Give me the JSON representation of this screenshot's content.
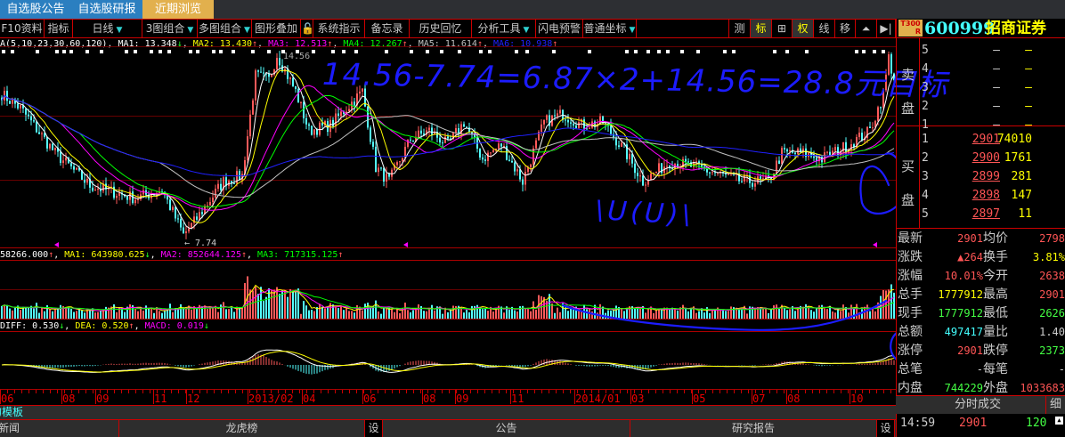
{
  "tabs": [
    {
      "label": "自选股公告"
    },
    {
      "label": "自选股研报"
    },
    {
      "label": "近期浏览",
      "active": true
    }
  ],
  "toolbar": {
    "left": [
      {
        "label": "F10资料"
      },
      {
        "label": "指标"
      },
      {
        "label": "日线",
        "dropdown": true
      },
      {
        "label": "3图组合",
        "dropdown": true
      },
      {
        "label": "多图组合",
        "dropdown": true
      },
      {
        "label": "图形叠加"
      },
      {
        "label": "🔓",
        "icon": "unlock-icon"
      },
      {
        "label": "系统指示"
      },
      {
        "label": "备忘录"
      },
      {
        "label": "历史回忆"
      },
      {
        "label": "分析工具",
        "dropdown": true
      },
      {
        "label": "闪电预警"
      },
      {
        "label": "普通坐标",
        "dropdown": true
      }
    ],
    "right": [
      {
        "label": "测"
      },
      {
        "label": "标",
        "active": true
      },
      {
        "label": "⊞"
      },
      {
        "label": "权",
        "active": true
      },
      {
        "label": "线"
      },
      {
        "label": "移"
      },
      {
        "label": "⏶"
      },
      {
        "label": "▶|"
      }
    ]
  },
  "stock": {
    "badge_top": "T300",
    "badge_bottom": "R",
    "code": "600999",
    "name": "招商证券"
  },
  "ma_legend": {
    "prefix": "A(5,10,23,30,60,120)",
    "items": [
      {
        "label": "MA1: 13.348",
        "arrow": "↓",
        "color": "#ffffff"
      },
      {
        "label": "MA2: 13.430",
        "arrow": "↑",
        "color": "#ffff00"
      },
      {
        "label": "MA3: 12.513",
        "arrow": "↑",
        "color": "#ff00ff"
      },
      {
        "label": "MA4: 12.267",
        "arrow": "↑",
        "color": "#00ff00"
      },
      {
        "label": "MA5: 11.614",
        "arrow": "↑",
        "color": "#c0c0c0"
      },
      {
        "label": "MA6: 10.938",
        "arrow": "↑",
        "color": "#2020ff"
      }
    ]
  },
  "vol_legend": {
    "prefix": "58266.000",
    "prefix_arrow": "↑",
    "items": [
      {
        "label": "MA1: 643980.625",
        "arrow": "↓",
        "color": "#ffff00"
      },
      {
        "label": "MA2: 852644.125",
        "arrow": "↑",
        "color": "#ff00ff"
      },
      {
        "label": "MA3: 717315.125",
        "arrow": "↑",
        "color": "#00ff00"
      }
    ]
  },
  "macd_legend": {
    "items": [
      {
        "label": "DIFF: 0.530",
        "arrow": "↓",
        "color": "#ffffff"
      },
      {
        "label": "DEA: 0.520",
        "arrow": "↑",
        "color": "#ffff00"
      },
      {
        "label": "MACD: 0.019",
        "arrow": "↓",
        "color": "#ff00ff"
      }
    ]
  },
  "price_marks": {
    "low": "7.74",
    "high": "14.56"
  },
  "annotations": {
    "formula": "14.56-7.74=6.87×2+14.56=28.8元目标",
    "scribble": "\\U(U)\\"
  },
  "x_axis": {
    "labels": [
      "06",
      "08",
      "09",
      "11",
      "12",
      "2013/02",
      "04",
      "06",
      "08",
      "09",
      "11",
      "2014/01",
      "03",
      "05",
      "07",
      "08",
      "10"
    ]
  },
  "template_bar": {
    "label": "的模板"
  },
  "bottom_tabs": [
    {
      "label": "新闻"
    },
    {
      "label": "龙虎榜"
    },
    {
      "label": "设"
    },
    {
      "label": "公告"
    },
    {
      "label": "研究报告"
    },
    {
      "label": "设"
    }
  ],
  "orderbook": {
    "sell_label": [
      "卖",
      "盘"
    ],
    "buy_label": [
      "买",
      "盘"
    ],
    "sell": [
      {
        "level": "5",
        "price": "—",
        "vol": "—"
      },
      {
        "level": "4",
        "price": "—",
        "vol": "—"
      },
      {
        "level": "3",
        "price": "—",
        "vol": "—"
      },
      {
        "level": "2",
        "price": "—",
        "vol": "—"
      },
      {
        "level": "1",
        "price": "—",
        "vol": "—"
      }
    ],
    "buy": [
      {
        "level": "1",
        "price": "2901",
        "vol": "74010"
      },
      {
        "level": "2",
        "price": "2900",
        "vol": "1761"
      },
      {
        "level": "3",
        "price": "2899",
        "vol": "281"
      },
      {
        "level": "4",
        "price": "2898",
        "vol": "147"
      },
      {
        "level": "5",
        "price": "2897",
        "vol": "11"
      }
    ]
  },
  "stats": [
    {
      "k1": "最新",
      "v1": "2901",
      "c1": "r",
      "k2": "均价",
      "v2": "2798",
      "c2": "r"
    },
    {
      "k1": "涨跌",
      "v1": "▲264",
      "c1": "r",
      "k2": "换手",
      "v2": "3.81%",
      "c2": "y"
    },
    {
      "k1": "涨幅",
      "v1": "10.01%",
      "c1": "r",
      "k2": "今开",
      "v2": "2638",
      "c2": "r"
    },
    {
      "k1": "总手",
      "v1": "1777912",
      "c1": "y",
      "k2": "最高",
      "v2": "2901",
      "c2": "r"
    },
    {
      "k1": "现手",
      "v1": "1777912",
      "c1": "g",
      "k2": "最低",
      "v2": "2626",
      "c2": "g"
    },
    {
      "k1": "总额",
      "v1": "497417",
      "c1": "c",
      "k2": "量比",
      "v2": "1.40",
      "c2": "w"
    },
    {
      "k1": "涨停",
      "v1": "2901",
      "c1": "r",
      "k2": "跌停",
      "v2": "2373",
      "c2": "g"
    },
    {
      "k1": "总笔",
      "v1": "-",
      "c1": "w",
      "k2": "每笔",
      "v2": "-",
      "c2": "w"
    },
    {
      "k1": "内盘",
      "v1": "744229",
      "c1": "g",
      "k2": "外盘",
      "v2": "1033683",
      "c2": "r"
    }
  ],
  "ticks": {
    "title": "分时成交",
    "detail_button": "细",
    "rows": [
      {
        "time": "14:59",
        "price": "2901",
        "vol": "120"
      }
    ]
  },
  "chart_data": {
    "type": "candlestick",
    "ylim": [
      7.55,
      14.7
    ],
    "approx_close_waypoints": [
      [
        0,
        13.0
      ],
      [
        7,
        12.5
      ],
      [
        20,
        10.9
      ],
      [
        33,
        9.75
      ],
      [
        50,
        9.3
      ],
      [
        60,
        9.6
      ],
      [
        68,
        8.0
      ],
      [
        72,
        8.45
      ],
      [
        83,
        9.9
      ],
      [
        90,
        10.1
      ],
      [
        95,
        13.65
      ],
      [
        100,
        13.5
      ],
      [
        103,
        14.4
      ],
      [
        110,
        13.1
      ],
      [
        115,
        11.7
      ],
      [
        123,
        11.9
      ],
      [
        135,
        13.1
      ],
      [
        140,
        10.4
      ],
      [
        145,
        9.9
      ],
      [
        153,
        11.4
      ],
      [
        160,
        11.7
      ],
      [
        167,
        11.2
      ],
      [
        173,
        12.0
      ],
      [
        180,
        10.7
      ],
      [
        187,
        11.2
      ],
      [
        195,
        9.9
      ],
      [
        203,
        12.0
      ],
      [
        210,
        12.3
      ],
      [
        217,
        11.9
      ],
      [
        225,
        12.0
      ],
      [
        233,
        11.0
      ],
      [
        240,
        9.9
      ],
      [
        250,
        10.6
      ],
      [
        260,
        10.4
      ],
      [
        267,
        10.2
      ],
      [
        277,
        9.9
      ],
      [
        287,
        9.9
      ],
      [
        292,
        10.9
      ],
      [
        300,
        10.9
      ],
      [
        307,
        10.7
      ],
      [
        317,
        11.2
      ],
      [
        325,
        11.7
      ],
      [
        330,
        13.0
      ],
      [
        332,
        14.3
      ],
      [
        334,
        13.5
      ]
    ],
    "ma_periods": [
      5,
      10,
      23,
      30,
      60,
      120
    ],
    "low_label": "7.74",
    "high_label": "14.56"
  }
}
